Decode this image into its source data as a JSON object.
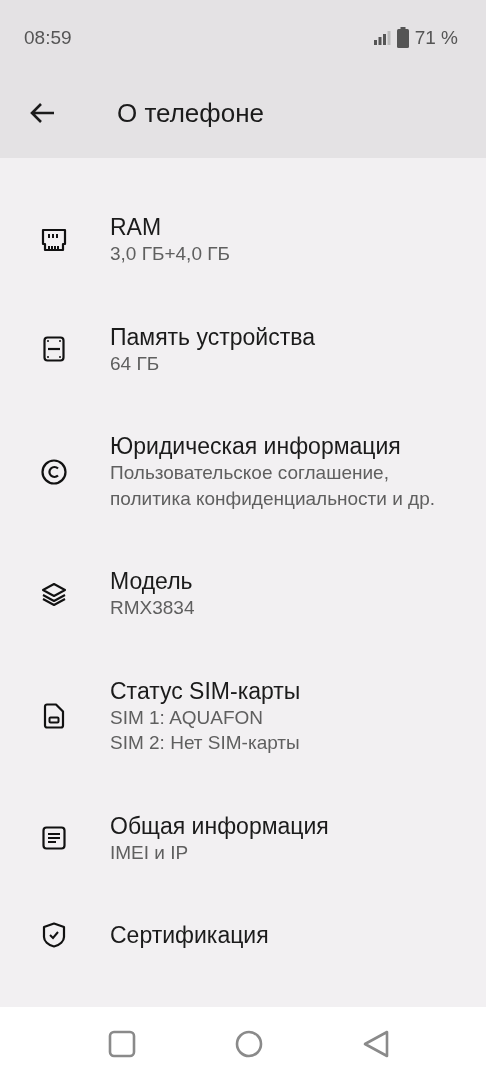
{
  "status_bar": {
    "time": "08:59",
    "battery": "71 %"
  },
  "app_bar": {
    "title": "О телефоне"
  },
  "items": [
    {
      "title": "RAM",
      "subtitle": [
        "3,0 ГБ+4,0 ГБ"
      ]
    },
    {
      "title": "Память устройства",
      "subtitle": [
        "64 ГБ"
      ]
    },
    {
      "title": "Юридическая информация",
      "subtitle": [
        "Пользовательское соглашение, политика конфиденциальности и др."
      ]
    },
    {
      "title": "Модель",
      "subtitle": [
        "RMX3834"
      ]
    },
    {
      "title": "Статус SIM-карты",
      "subtitle": [
        "SIM 1: AQUAFON",
        "SIM 2: Нет SIM-карты"
      ]
    },
    {
      "title": "Общая информация",
      "subtitle": [
        "IMEI и IP"
      ]
    },
    {
      "title": "Сертификация"
    }
  ]
}
